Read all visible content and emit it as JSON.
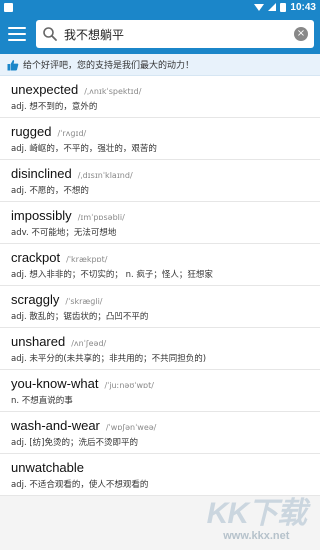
{
  "status_bar": {
    "time": "10:43"
  },
  "search": {
    "value": "我不想躺平"
  },
  "banner": {
    "text": "给个好评吧，您的支持是我们最大的动力！"
  },
  "results": [
    {
      "word": "unexpected",
      "phonetic": "/ˌʌnɪkˈspektɪd/",
      "definition": "adj. 想不到的，意外的"
    },
    {
      "word": "rugged",
      "phonetic": "/ˈrʌɡɪd/",
      "definition": "adj. 崎岖的，不平的，强壮的，艰苦的"
    },
    {
      "word": "disinclined",
      "phonetic": "/ˌdɪsɪnˈklaɪnd/",
      "definition": "adj. 不愿的，不想的"
    },
    {
      "word": "impossibly",
      "phonetic": "/ɪmˈpɒsəbli/",
      "definition": "adv. 不可能地；无法可想地"
    },
    {
      "word": "crackpot",
      "phonetic": "/ˈkrækpɒt/",
      "definition": "adj. 想入非非的；不切实的；  n. 疯子；怪人；狂想家"
    },
    {
      "word": "scraggly",
      "phonetic": "/ˈskræɡli/",
      "definition": "adj. 散乱的；锯齿状的；凸凹不平的"
    },
    {
      "word": "unshared",
      "phonetic": "/ʌnˈʃeəd/",
      "definition": "adj. 未平分的(未共享的；非共用的；不共同担负的)"
    },
    {
      "word": "you-know-what",
      "phonetic": "/ˈjuːnəʊˈwɒt/",
      "definition": "n. 不想直说的事"
    },
    {
      "word": "wash-and-wear",
      "phonetic": "/ˈwɒʃənˈweə/",
      "definition": "adj. [纺]免烫的；洗后不烫即平的"
    },
    {
      "word": "unwatchable",
      "phonetic": "",
      "definition": "adj. 不适合观看的，使人不想观看的"
    }
  ],
  "watermark": {
    "logo": "KK下载",
    "url": "www.kkx.net"
  },
  "colors": {
    "primary": "#1b86c9",
    "banner_bg": "#e8f2fb"
  }
}
